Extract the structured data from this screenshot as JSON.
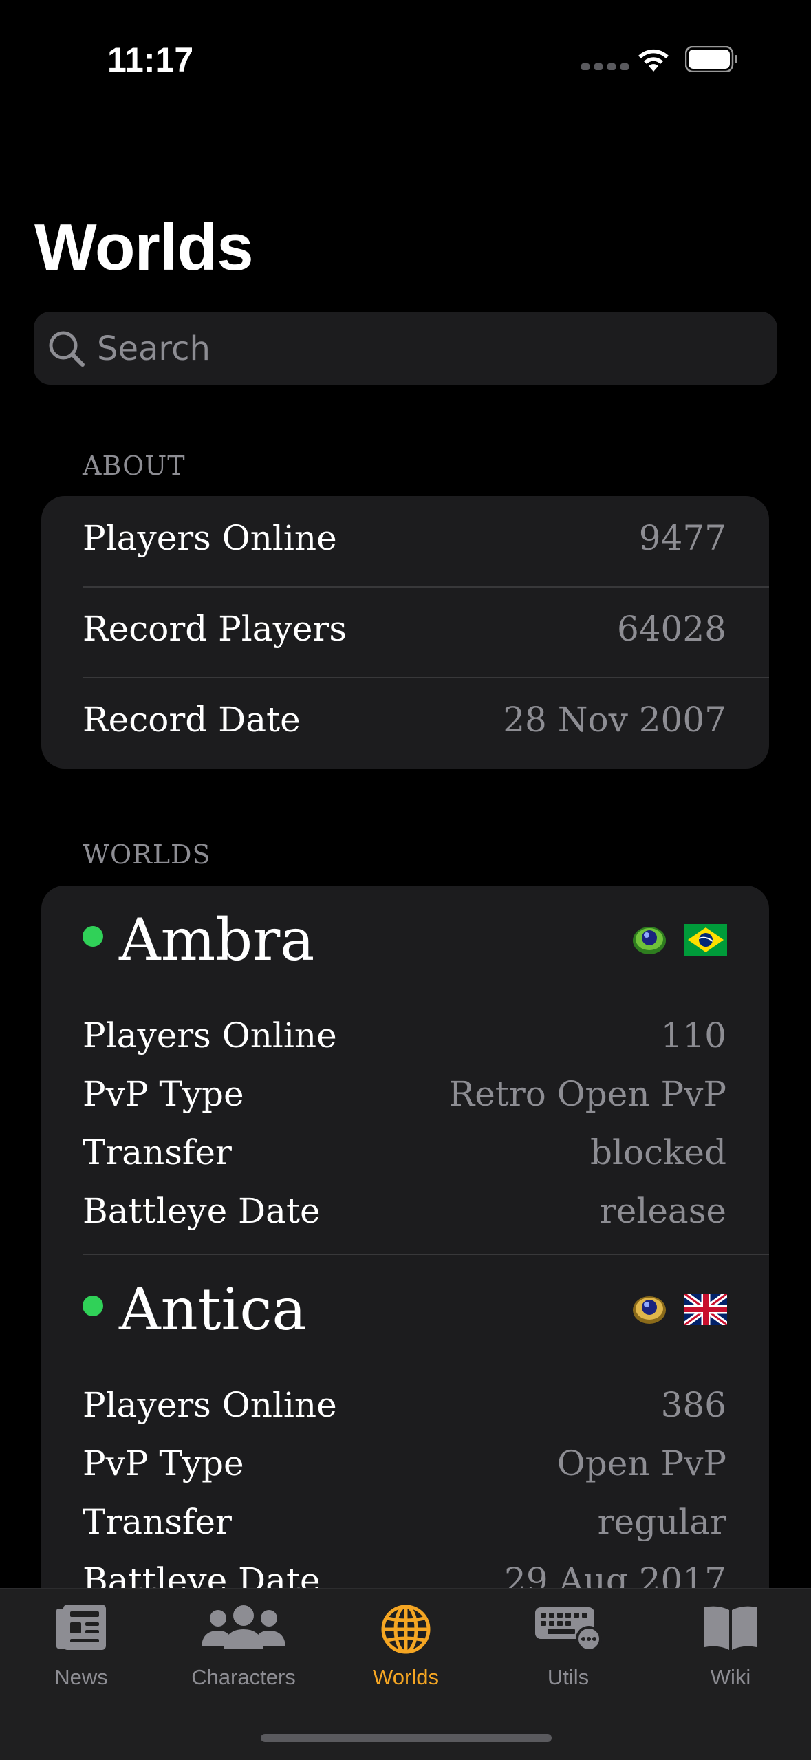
{
  "status_bar": {
    "time": "11:17"
  },
  "page_title": "Worlds",
  "search": {
    "placeholder": "Search",
    "value": ""
  },
  "about": {
    "header": "ABOUT",
    "rows": [
      {
        "label": "Players Online",
        "value": "9477"
      },
      {
        "label": "Record Players",
        "value": "64028"
      },
      {
        "label": "Record Date",
        "value": "28 Nov 2007"
      }
    ]
  },
  "worlds_section": {
    "header": "WORLDS",
    "worlds": [
      {
        "name": "Ambra",
        "status": "online",
        "status_color": "#30d158",
        "orb_icon": "green-battleye-orb-icon",
        "flag_icon": "brazil-flag-icon",
        "rows": [
          {
            "label": "Players Online",
            "value": "110"
          },
          {
            "label": "PvP Type",
            "value": "Retro Open PvP"
          },
          {
            "label": "Transfer",
            "value": "blocked"
          },
          {
            "label": "Battleye Date",
            "value": "release"
          }
        ]
      },
      {
        "name": "Antica",
        "status": "online",
        "status_color": "#30d158",
        "orb_icon": "yellow-battleye-orb-icon",
        "flag_icon": "uk-flag-icon",
        "rows": [
          {
            "label": "Players Online",
            "value": "386"
          },
          {
            "label": "PvP Type",
            "value": "Open PvP"
          },
          {
            "label": "Transfer",
            "value": "regular"
          },
          {
            "label": "Battleye Date",
            "value": "29 Aug 2017"
          }
        ]
      }
    ]
  },
  "tab_bar": {
    "accent_color": "#f5a623",
    "inactive_color": "#8d8d93",
    "tabs": [
      {
        "label": "News",
        "icon": "newspaper-icon",
        "active": false
      },
      {
        "label": "Characters",
        "icon": "people-icon",
        "active": false
      },
      {
        "label": "Worlds",
        "icon": "globe-icon",
        "active": true
      },
      {
        "label": "Utils",
        "icon": "keyboard-icon",
        "active": false
      },
      {
        "label": "Wiki",
        "icon": "book-icon",
        "active": false
      }
    ]
  }
}
